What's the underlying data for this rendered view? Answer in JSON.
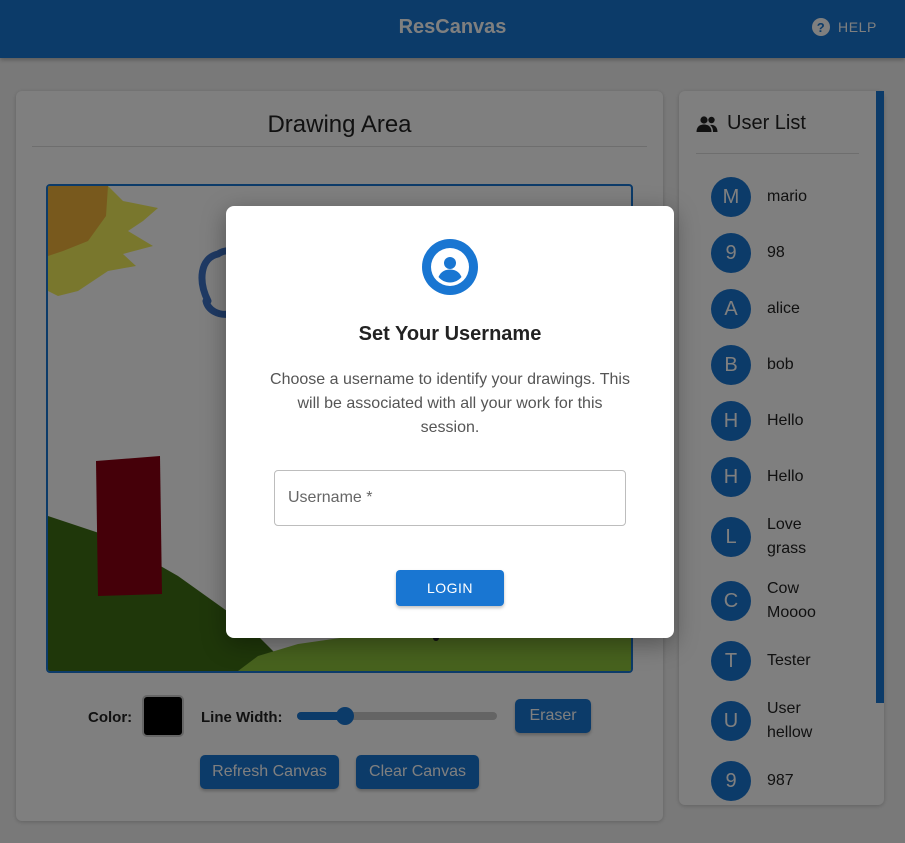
{
  "app": {
    "title": "ResCanvas",
    "help_label": "HELP"
  },
  "drawing_panel": {
    "title": "Drawing Area",
    "color_label": "Color:",
    "current_color": "#000000",
    "line_width_label": "Line Width:",
    "line_width_fraction": 0.24,
    "eraser_label": "Eraser",
    "refresh_label": "Refresh Canvas",
    "clear_label": "Clear Canvas"
  },
  "user_panel": {
    "title": "User List",
    "users": [
      {
        "initial": "M",
        "name": "mario"
      },
      {
        "initial": "9",
        "name": "98"
      },
      {
        "initial": "A",
        "name": "alice"
      },
      {
        "initial": "B",
        "name": "bob"
      },
      {
        "initial": "H",
        "name": "Hello"
      },
      {
        "initial": "H",
        "name": "Hello"
      },
      {
        "initial": "L",
        "name": "Love grass"
      },
      {
        "initial": "C",
        "name": "Cow Moooo"
      },
      {
        "initial": "T",
        "name": "Tester"
      },
      {
        "initial": "U",
        "name": "User hellow"
      },
      {
        "initial": "9",
        "name": "987"
      }
    ]
  },
  "modal": {
    "title": "Set Your Username",
    "description": "Choose a username to identify your drawings. This will be associated with all your work for this session.",
    "username_label": "Username *",
    "username_value": "",
    "login_label": "LOGIN"
  },
  "colors": {
    "primary": "#1976d2",
    "overlay": "rgba(0,0,0,0.5)"
  },
  "icons": {
    "help": "help-circle-icon",
    "users": "people-icon",
    "modal": "account-circle-icon"
  }
}
